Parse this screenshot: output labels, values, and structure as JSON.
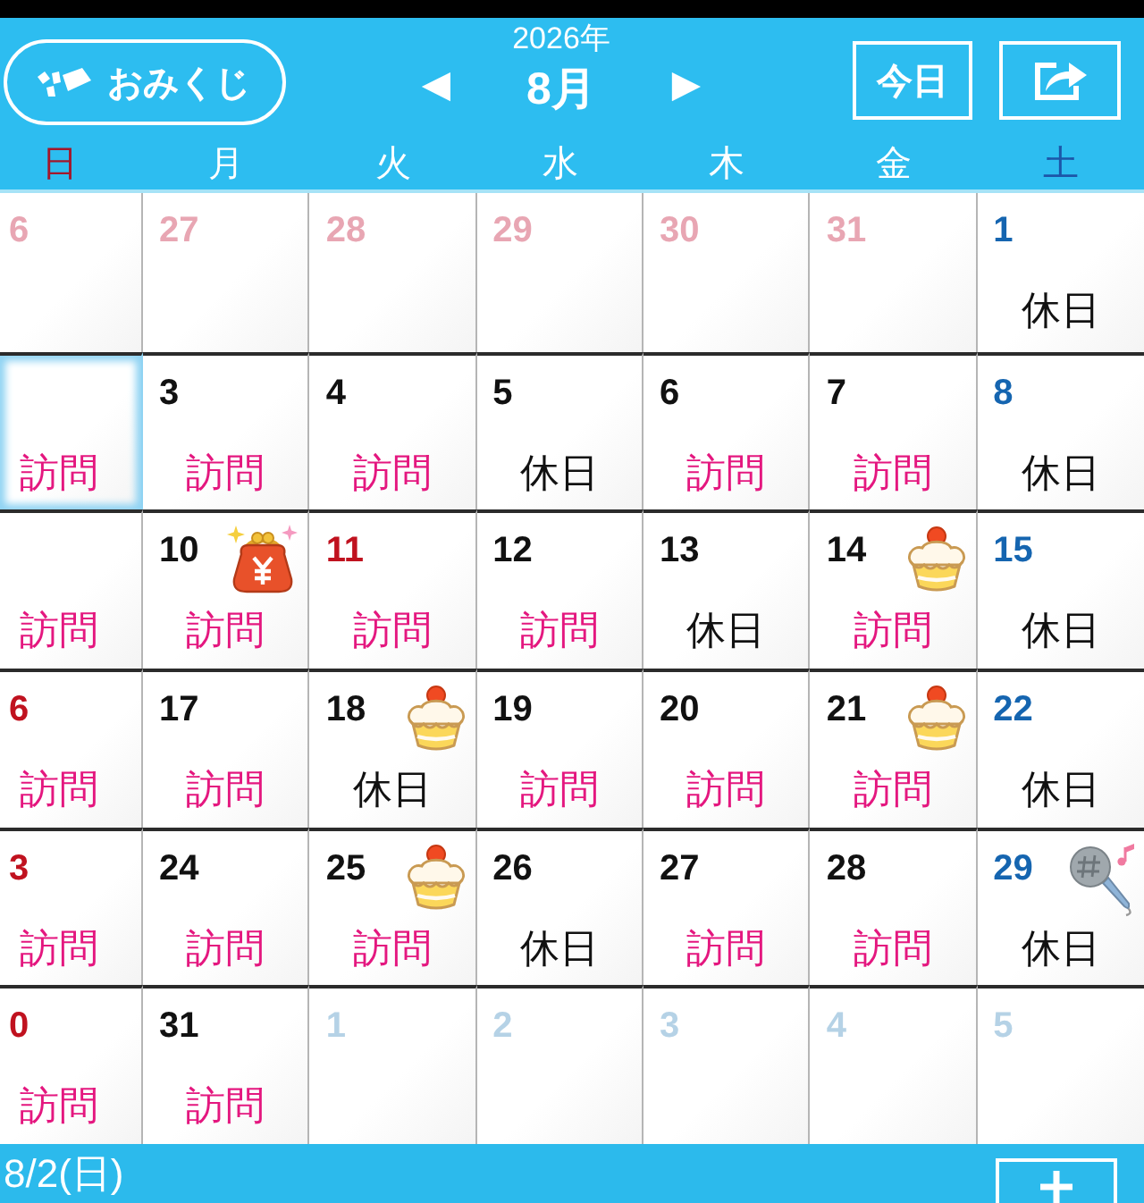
{
  "header": {
    "omikuji_button": "おみくじ",
    "year": "2026年",
    "month": "8月",
    "prev_button": "◀",
    "next_button": "▶",
    "today_button": "今日"
  },
  "weekdays": [
    {
      "label": "日",
      "kind": "sunday"
    },
    {
      "label": "月",
      "kind": "weekday"
    },
    {
      "label": "火",
      "kind": "weekday"
    },
    {
      "label": "水",
      "kind": "weekday"
    },
    {
      "label": "木",
      "kind": "weekday"
    },
    {
      "label": "金",
      "kind": "weekday"
    },
    {
      "label": "土",
      "kind": "saturday"
    }
  ],
  "weeks": [
    {
      "days": [
        {
          "date": "6",
          "kind": "prev_month",
          "selected": false
        },
        {
          "date": "27",
          "kind": "prev_month",
          "selected": false
        },
        {
          "date": "28",
          "kind": "prev_month",
          "selected": false
        },
        {
          "date": "29",
          "kind": "prev_month",
          "selected": false
        },
        {
          "date": "30",
          "kind": "prev_month",
          "selected": false
        },
        {
          "date": "31",
          "kind": "prev_month",
          "selected": false
        },
        {
          "date": "1",
          "kind": "saturday",
          "selected": false,
          "event": {
            "label": "休日",
            "color": "#111111"
          }
        }
      ]
    },
    {
      "days": [
        {
          "selected": true,
          "event": {
            "label": "訪問",
            "color": "#e4177f"
          }
        },
        {
          "date": "3",
          "kind": "weekday",
          "selected": false,
          "event": {
            "label": "訪問",
            "color": "#e4177f"
          }
        },
        {
          "date": "4",
          "kind": "weekday",
          "selected": false,
          "event": {
            "label": "訪問",
            "color": "#e4177f"
          }
        },
        {
          "date": "5",
          "kind": "weekday",
          "selected": false,
          "event": {
            "label": "休日",
            "color": "#111111"
          }
        },
        {
          "date": "6",
          "kind": "weekday",
          "selected": false,
          "event": {
            "label": "訪問",
            "color": "#e4177f"
          }
        },
        {
          "date": "7",
          "kind": "weekday",
          "selected": false,
          "event": {
            "label": "訪問",
            "color": "#e4177f"
          }
        },
        {
          "date": "8",
          "kind": "saturday",
          "selected": false,
          "event": {
            "label": "休日",
            "color": "#111111"
          }
        }
      ]
    },
    {
      "days": [
        {
          "selected": false,
          "event": {
            "label": "訪問",
            "color": "#e4177f"
          }
        },
        {
          "date": "10",
          "kind": "weekday",
          "selected": false,
          "sticker": {
            "kind": "purse"
          },
          "event": {
            "label": "訪問",
            "color": "#e4177f"
          }
        },
        {
          "date": "11",
          "kind": "holiday",
          "selected": false,
          "event": {
            "label": "訪問",
            "color": "#e4177f"
          }
        },
        {
          "date": "12",
          "kind": "weekday",
          "selected": false,
          "event": {
            "label": "訪問",
            "color": "#e4177f"
          }
        },
        {
          "date": "13",
          "kind": "weekday",
          "selected": false,
          "event": {
            "label": "休日",
            "color": "#111111"
          }
        },
        {
          "date": "14",
          "kind": "weekday",
          "selected": false,
          "sticker": {
            "kind": "cake"
          },
          "event": {
            "label": "訪問",
            "color": "#e4177f"
          }
        },
        {
          "date": "15",
          "kind": "saturday",
          "selected": false,
          "event": {
            "label": "休日",
            "color": "#111111"
          }
        }
      ]
    },
    {
      "days": [
        {
          "date": "6",
          "kind": "sunday",
          "selected": false,
          "event": {
            "label": "訪問",
            "color": "#e4177f"
          }
        },
        {
          "date": "17",
          "kind": "weekday",
          "selected": false,
          "event": {
            "label": "訪問",
            "color": "#e4177f"
          }
        },
        {
          "date": "18",
          "kind": "weekday",
          "selected": false,
          "sticker": {
            "kind": "cake"
          },
          "event": {
            "label": "休日",
            "color": "#111111"
          }
        },
        {
          "date": "19",
          "kind": "weekday",
          "selected": false,
          "event": {
            "label": "訪問",
            "color": "#e4177f"
          }
        },
        {
          "date": "20",
          "kind": "weekday",
          "selected": false,
          "event": {
            "label": "訪問",
            "color": "#e4177f"
          }
        },
        {
          "date": "21",
          "kind": "weekday",
          "selected": false,
          "sticker": {
            "kind": "cake"
          },
          "event": {
            "label": "訪問",
            "color": "#e4177f"
          }
        },
        {
          "date": "22",
          "kind": "saturday",
          "selected": false,
          "event": {
            "label": "休日",
            "color": "#111111"
          }
        }
      ]
    },
    {
      "days": [
        {
          "date": "3",
          "kind": "sunday",
          "selected": false,
          "event": {
            "label": "訪問",
            "color": "#e4177f"
          }
        },
        {
          "date": "24",
          "kind": "weekday",
          "selected": false,
          "event": {
            "label": "訪問",
            "color": "#e4177f"
          }
        },
        {
          "date": "25",
          "kind": "weekday",
          "selected": false,
          "sticker": {
            "kind": "cake"
          },
          "event": {
            "label": "訪問",
            "color": "#e4177f"
          }
        },
        {
          "date": "26",
          "kind": "weekday",
          "selected": false,
          "event": {
            "label": "休日",
            "color": "#111111"
          }
        },
        {
          "date": "27",
          "kind": "weekday",
          "selected": false,
          "event": {
            "label": "訪問",
            "color": "#e4177f"
          }
        },
        {
          "date": "28",
          "kind": "weekday",
          "selected": false,
          "event": {
            "label": "訪問",
            "color": "#e4177f"
          }
        },
        {
          "date": "29",
          "kind": "saturday",
          "selected": false,
          "sticker": {
            "kind": "microphone"
          },
          "event": {
            "label": "休日",
            "color": "#111111"
          }
        }
      ]
    },
    {
      "days": [
        {
          "date": "0",
          "kind": "sunday",
          "selected": false,
          "event": {
            "label": "訪問",
            "color": "#e4177f"
          }
        },
        {
          "date": "31",
          "kind": "weekday",
          "selected": false,
          "event": {
            "label": "訪問",
            "color": "#e4177f"
          }
        },
        {
          "date": "1",
          "kind": "next_month",
          "selected": false
        },
        {
          "date": "2",
          "kind": "next_month",
          "selected": false
        },
        {
          "date": "3",
          "kind": "next_month",
          "selected": false
        },
        {
          "date": "4",
          "kind": "next_month",
          "selected": false
        },
        {
          "date": "5",
          "kind": "next_month",
          "selected": false
        }
      ]
    }
  ],
  "bottom_bar": {
    "selected_date": "8/2(日)"
  }
}
